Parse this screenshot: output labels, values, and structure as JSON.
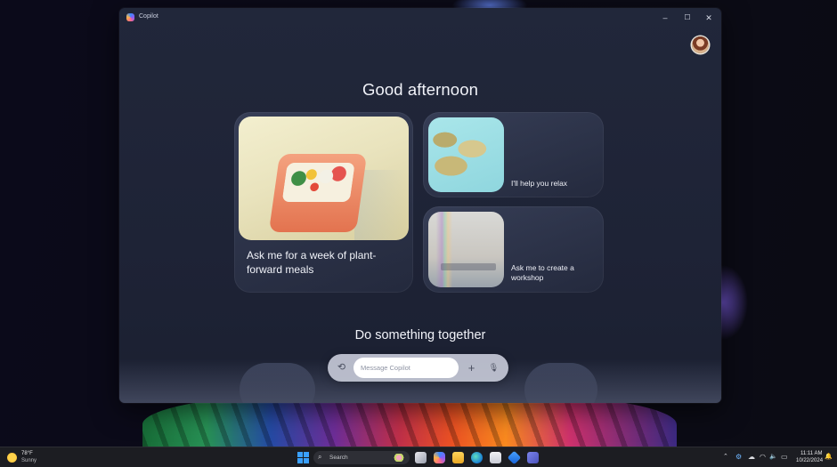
{
  "window": {
    "title": "Copilot",
    "controls": {
      "minimize": "–",
      "maximize": "☐",
      "close": "✕"
    }
  },
  "greeting": "Good afternoon",
  "cards": [
    {
      "text": "Ask me for a week of plant-forward meals"
    },
    {
      "text": "I'll help you relax"
    },
    {
      "text": "Ask me to create a workshop"
    }
  ],
  "section_title": "Do something together",
  "composer": {
    "placeholder": "Message Copilot",
    "history_icon": "⟲",
    "add_icon": "+",
    "mic_icon": "🎙"
  },
  "taskbar": {
    "weather": {
      "temp": "78°F",
      "condition": "Sunny"
    },
    "search_label": "Search",
    "search_icon": "⌕",
    "time": "11:11 AM",
    "date": "10/22/2024",
    "tray_glyphs": {
      "chevron": "⌃",
      "network": "⚙",
      "cloud": "☁",
      "wifi": "◠",
      "volume": "🔈",
      "battery": "▭",
      "bell": "🔔"
    }
  },
  "colors": {
    "window_bg": "#21273a",
    "accent_blue": "#3aa0ff"
  }
}
